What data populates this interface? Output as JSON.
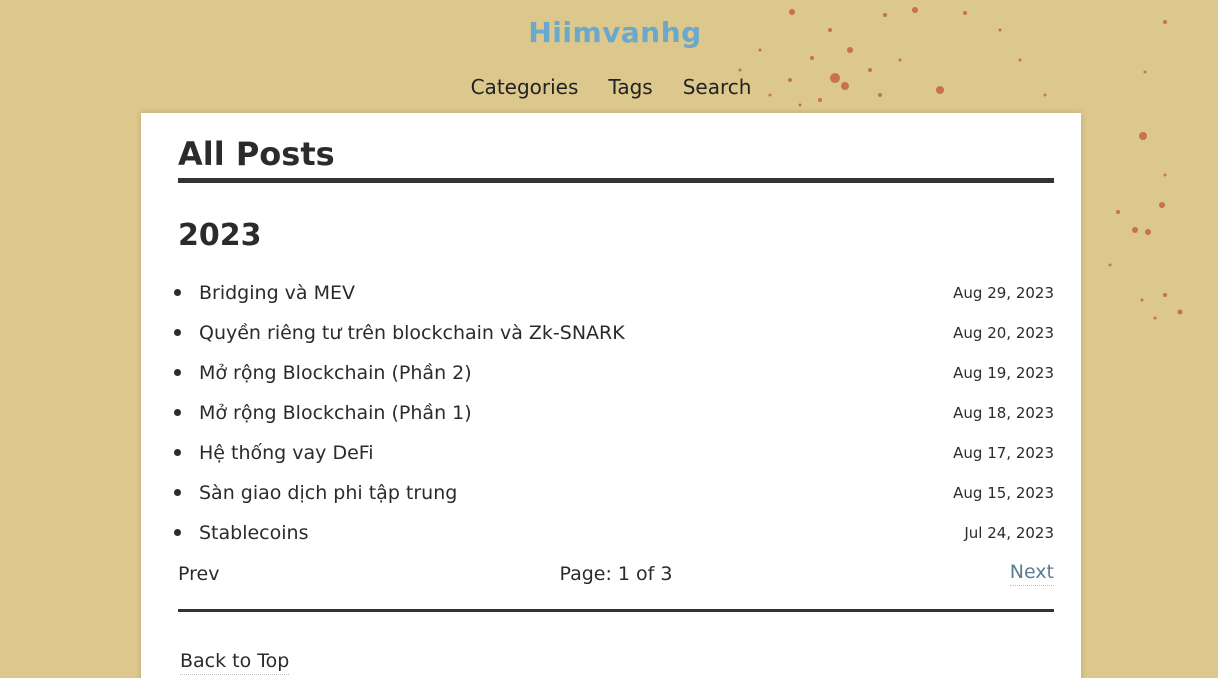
{
  "site": {
    "title": "Hiimvanhg"
  },
  "nav": {
    "items": [
      {
        "label": "Categories"
      },
      {
        "label": "Tags"
      },
      {
        "label": "Search"
      }
    ]
  },
  "main": {
    "title": "All Posts",
    "year": "2023",
    "posts": [
      {
        "title": "Bridging và MEV",
        "date": "Aug 29, 2023"
      },
      {
        "title": "Quyền riêng tư trên blockchain và Zk-SNARK",
        "date": "Aug 20, 2023"
      },
      {
        "title": "Mở rộng Blockchain (Phần 2)",
        "date": "Aug 19, 2023"
      },
      {
        "title": "Mở rộng Blockchain (Phần 1)",
        "date": "Aug 18, 2023"
      },
      {
        "title": "Hệ thống vay DeFi",
        "date": "Aug 17, 2023"
      },
      {
        "title": "Sàn giao dịch phi tập trung",
        "date": "Aug 15, 2023"
      },
      {
        "title": "Stablecoins",
        "date": "Jul 24, 2023"
      }
    ],
    "pagination": {
      "prev_label": "Prev",
      "page_info": "Page: 1 of 3",
      "next_label": "Next"
    },
    "back_to_top": "Back to Top"
  },
  "colors": {
    "background": "#dcc78c",
    "site_title": "#6aa8cc",
    "next_link": "#5a7d93",
    "splatter": "#c0392b"
  }
}
